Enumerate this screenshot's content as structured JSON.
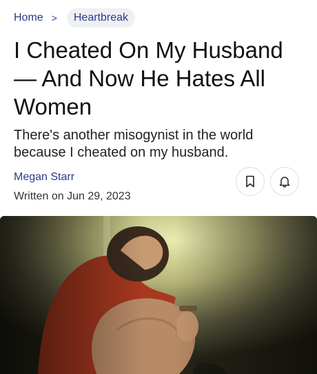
{
  "breadcrumb": {
    "home": "Home",
    "separator": ">",
    "current": "Heartbreak"
  },
  "article": {
    "title": "I Cheated On My Husband — And Now He Hates All Women",
    "dek": "There's another misogynist in the world because I cheated on my husband.",
    "author": "Megan Starr",
    "written": "Written on Jun 29, 2023"
  },
  "actions": {
    "bookmark_icon": "bookmark-icon",
    "bell_icon": "bell-icon"
  },
  "hero": {
    "description_icon": "photo"
  },
  "colors": {
    "link": "#2b3a8c",
    "chip_bg": "#eef0f4",
    "text": "#111111"
  }
}
